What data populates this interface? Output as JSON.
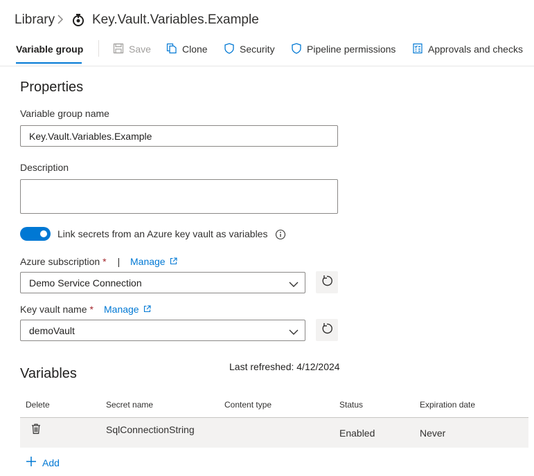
{
  "breadcrumb": {
    "root": "Library",
    "separator": ">",
    "icon": "variable-group-icon",
    "title": "Key.Vault.Variables.Example"
  },
  "toolbar": {
    "active_tab": "Variable group",
    "save": "Save",
    "clone": "Clone",
    "security": "Security",
    "pipeline_permissions": "Pipeline permissions",
    "approvals": "Approvals and checks"
  },
  "properties": {
    "title": "Properties",
    "name_label": "Variable group name",
    "name_value": "Key.Vault.Variables.Example",
    "description_label": "Description",
    "description_value": "",
    "link_toggle_label": "Link secrets from an Azure key vault as variables",
    "link_toggle_on": true,
    "subscription_label": "Azure subscription",
    "required_mark": "*",
    "pipe": "|",
    "manage": "Manage",
    "subscription_value": "Demo Service Connection",
    "keyvault_label": "Key vault name",
    "keyvault_value": "demoVault"
  },
  "variables": {
    "title": "Variables",
    "last_refreshed": "Last refreshed: 4/12/2024",
    "columns": [
      "Delete",
      "Secret name",
      "Content type",
      "Status",
      "Expiration date"
    ],
    "rows": [
      {
        "secret_name": "SqlConnectionString",
        "content_type": "",
        "status": "Enabled",
        "expiration": "Never"
      }
    ],
    "add": "Add"
  },
  "colors": {
    "accent": "#0078d4",
    "required": "#a4262c",
    "row_background": "#f3f2f1"
  }
}
